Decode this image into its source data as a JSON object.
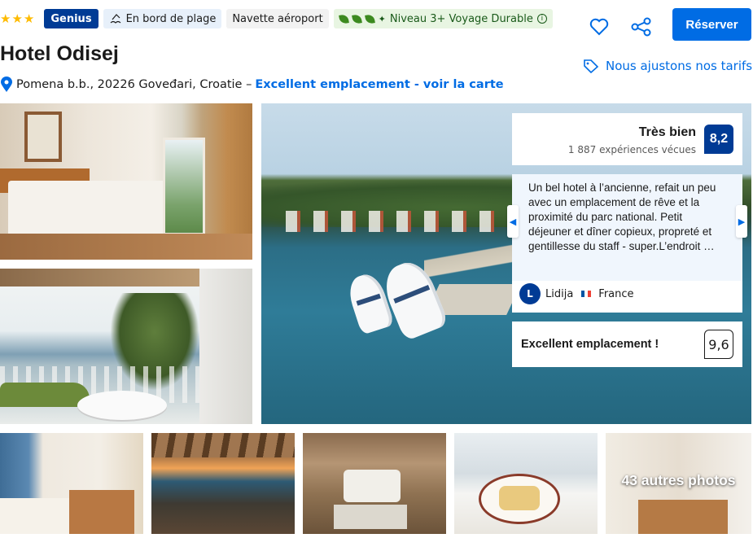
{
  "header": {
    "stars": [
      "★",
      "★",
      "★"
    ],
    "genius_badge": "Genius",
    "beach_chip": "En bord de plage",
    "shuttle_chip": "Navette aéroport",
    "sustainable_chip": "Niveau 3+ Voyage Durable",
    "reserve_button": "Réserver",
    "price_match": "Nous ajustons nos tarifs"
  },
  "hotel": {
    "name": "Hotel Odisej",
    "address": "Pomena b.b., 20226 Goveđari, Croatie –",
    "location_link": "Excellent emplacement - voir la carte"
  },
  "rating": {
    "label": "Très bien",
    "count": "1 887 expériences vécues",
    "score": "8,2"
  },
  "review": {
    "text": "Un bel hotel à l’ancienne, refait un peu avec un emplacement de rêve et la proximité du parc national. Petit déjeuner et dîner copieux, propreté et gentillesse du staff - super.L’endroit …",
    "reviewer_initial": "L",
    "reviewer_name": "Lidija",
    "reviewer_country": "France"
  },
  "location": {
    "label": "Excellent emplacement !",
    "score": "9,6"
  },
  "gallery": {
    "more_photos": "43 autres photos"
  },
  "colors": {
    "primary": "#006ce4",
    "genius": "#003b95",
    "star": "#febb02",
    "sustainable": "#e8f5e2"
  }
}
